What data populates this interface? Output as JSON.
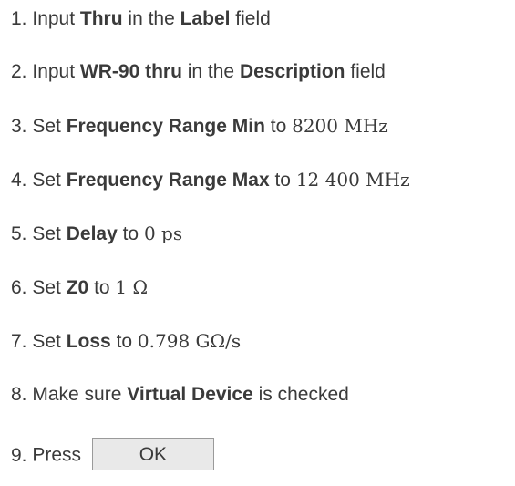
{
  "steps": [
    {
      "num": "1.",
      "parts": [
        "Input ",
        "Thru",
        " in the ",
        "Label",
        " field"
      ]
    },
    {
      "num": "2.",
      "parts": [
        "Input ",
        "WR-90 thru",
        " in the ",
        "Description",
        " field"
      ]
    },
    {
      "num": "3.",
      "parts": [
        "Set ",
        "Frequency Range Min",
        " to ",
        "8200 MHz"
      ]
    },
    {
      "num": "4.",
      "parts": [
        "Set ",
        "Frequency Range Max",
        " to ",
        "12 400 MHz"
      ]
    },
    {
      "num": "5.",
      "parts": [
        "Set ",
        "Delay",
        " to ",
        "0 ps"
      ]
    },
    {
      "num": "6.",
      "parts": [
        "Set ",
        "Z0",
        " to ",
        "1 Ω"
      ]
    },
    {
      "num": "7.",
      "parts": [
        "Set ",
        "Loss",
        " to ",
        "0.798 GΩ/s"
      ]
    },
    {
      "num": "8.",
      "parts": [
        "Make sure ",
        "Virtual Device",
        " is checked"
      ]
    },
    {
      "num": "9.",
      "parts": [
        "Press "
      ],
      "button_label": "OK"
    }
  ]
}
